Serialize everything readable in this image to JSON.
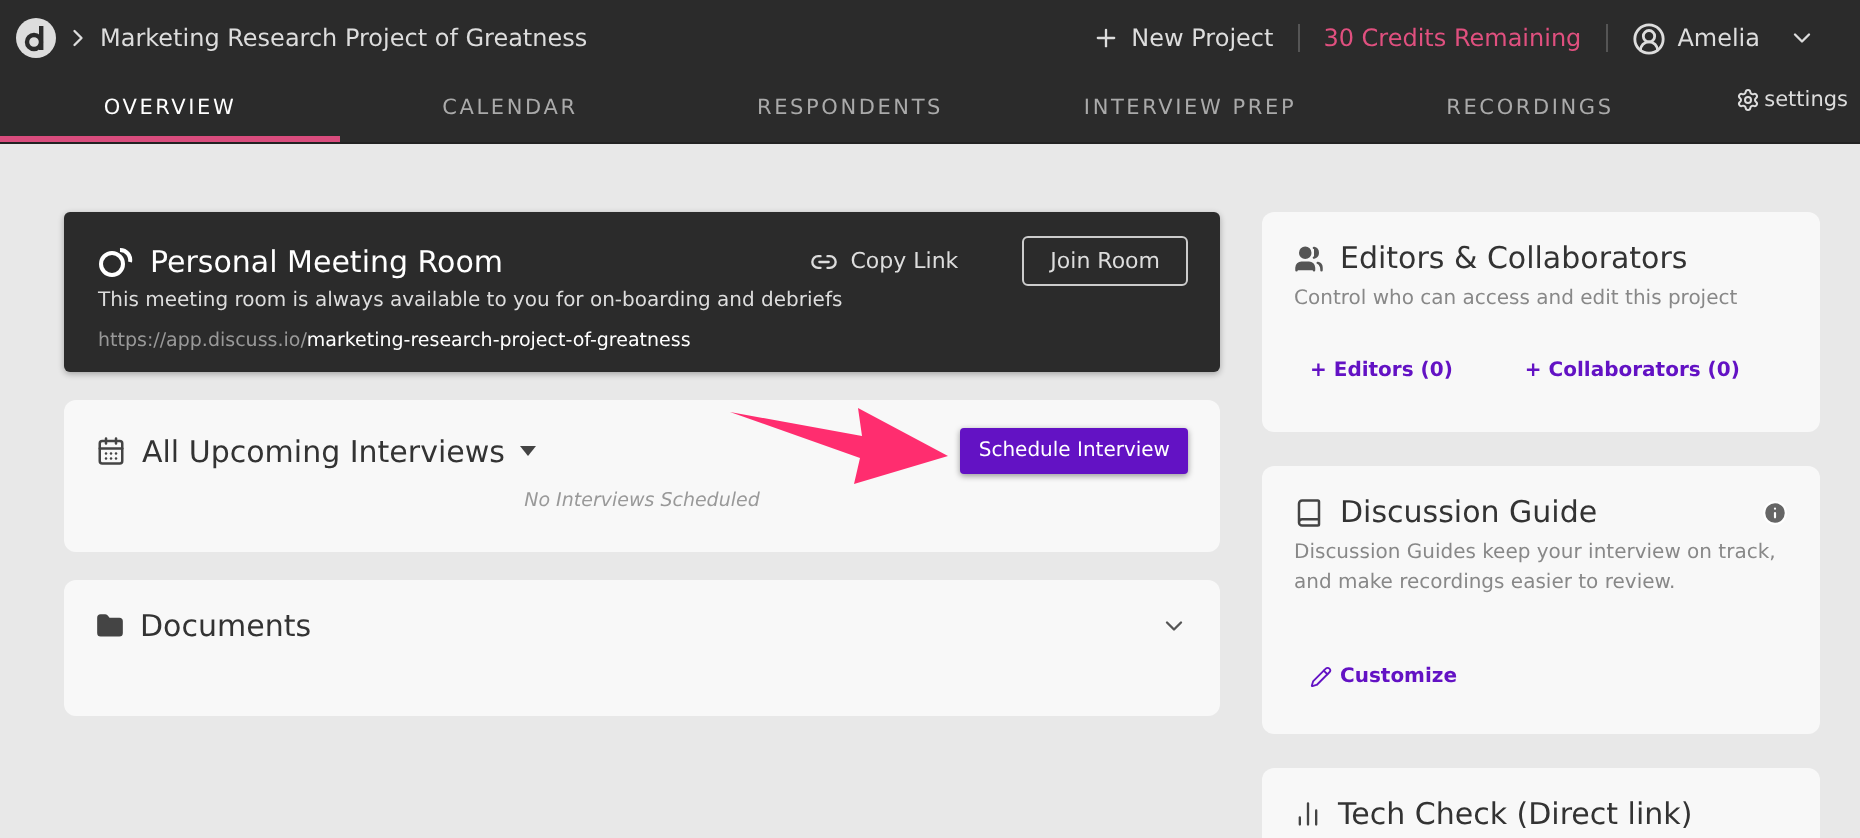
{
  "header": {
    "project_title": "Marketing Research Project of Greatness",
    "new_project": "New Project",
    "credits": "30 Credits Remaining",
    "user": "Amelia"
  },
  "tabs": [
    {
      "label": "OVERVIEW",
      "selected": true
    },
    {
      "label": "CALENDAR",
      "selected": false
    },
    {
      "label": "RESPONDENTS",
      "selected": false
    },
    {
      "label": "INTERVIEW PREP",
      "selected": false
    },
    {
      "label": "RECORDINGS",
      "selected": false
    }
  ],
  "settings": "settings",
  "meeting_room": {
    "title": "Personal Meeting Room",
    "copy_link": "Copy Link",
    "join": "Join Room",
    "description": "This meeting room is always available to you for on-boarding and debriefs",
    "url_base": "https://app.discuss.io/",
    "url_slug": "marketing-research-project-of-greatness"
  },
  "interviews": {
    "title": "All Upcoming Interviews",
    "button": "Schedule Interview",
    "empty": "No Interviews Scheduled"
  },
  "documents": {
    "title": "Documents",
    "expanded": false
  },
  "editors": {
    "title": "Editors & Collaborators",
    "description": "Control who can access and edit this project",
    "links": [
      "+ Editors (0)",
      "+ Collaborators (0)"
    ]
  },
  "guide": {
    "title": "Discussion Guide",
    "description": "Discussion Guides keep your interview on track, and make recordings easier to review.",
    "link": "Customize"
  },
  "tech_check": {
    "title": "Tech Check (Direct link)"
  }
}
